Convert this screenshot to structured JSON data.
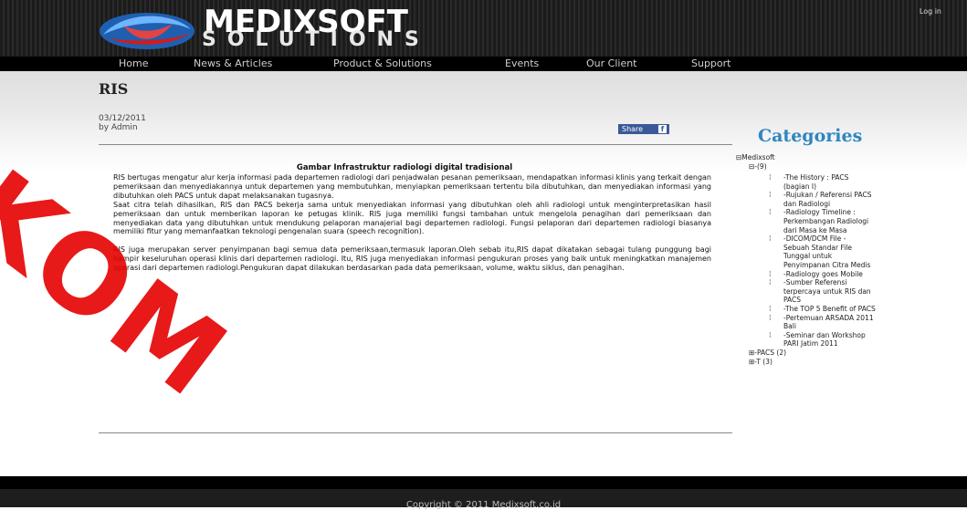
{
  "header": {
    "logo_line1": "MEDIXSOFT",
    "logo_line2": "SOLUTIONS",
    "login": "Log in"
  },
  "nav": {
    "items": [
      "Home",
      "News & Articles",
      "Product & Solutions",
      "Events",
      "Our Client",
      "Support"
    ]
  },
  "article": {
    "title": "RIS",
    "date": "03/12/2011",
    "author": "by Admin",
    "share": "Share",
    "image_caption": "Gambar Infrastruktur radiologi digital tradisional",
    "paragraph1": "RIS bertugas mengatur alur kerja informasi pada departemen radiologi dari penjadwalan pesanan pemeriksaan, mendapatkan informasi klinis yang terkait dengan pemeriksaan dan menyediakannya untuk departemen yang membutuhkan, menyiapkan pemeriksaan tertentu bila dibutuhkan, dan  menyediakan informasi yang dibutuhkan oleh PACS untuk dapat melaksanakan tugasnya.",
    "paragraph2": "Saat citra telah dihasilkan, RIS dan PACS bekerja sama untuk menyediakan informasi yang dibutuhkan oleh ahli radiologi untuk menginterpretasikan hasil pemeriksaan dan untuk memberikan laporan ke petugas klinik. RIS juga memiliki fungsi tambahan untuk mengelola penagihan dari pemeriksaan dan menyediakan data yang dibutuhkan untuk mendukung pelaporan manajerial bagi departemen radiologi. Fungsi pelaporan dari departemen radiologi biasanya memiliki fitur yang memanfaatkan teknologi pengenalan suara (speech recognition).",
    "paragraph3": "RIS juga merupakan server penyimpanan bagi semua data pemeriksaan,termasuk laporan.Oleh sebab itu,RIS dapat dikatakan sebagai tulang punggung bagi hampir keseluruhan operasi klinis dari departemen radiologi. Itu, RIS juga menyediakan informasi pengukuran proses yang baik untuk meningkatkan manajemen operasi dari departemen radiologi.Pengukuran dapat dilakukan berdasarkan pada data pemeriksaan, volume, waktu siklus, dan penagihan."
  },
  "categories": {
    "title": "Categories",
    "root": "Medixsoft",
    "group1": "-(9)",
    "leaves": [
      [
        "The History : PACS",
        "(bagian I)"
      ],
      [
        "Rujukan / Referensi PACS",
        "dan Radiologi"
      ],
      [
        "Radiology Timeline :",
        "Perkembangan Radiologi",
        "dari Masa ke Masa"
      ],
      [
        "DICOM/DCM File -",
        "Sebuah Standar File",
        "Tunggal untuk",
        "Penyimpanan Citra Medis"
      ],
      [
        "Radiology goes Mobile"
      ],
      [
        "Sumber Referensi",
        "terpercaya untuk RIS dan",
        "PACS"
      ],
      [
        "The TOP 5 Benefit of PACS"
      ],
      [
        "Pertemuan ARSADA 2011",
        "Bali"
      ],
      [
        "Seminar dan Workshop",
        "PARI Jatim 2011"
      ]
    ],
    "group2": "PACS (2)",
    "group3": "T (3)"
  },
  "footer": {
    "copyright": "Copyright © 2011 Medixsoft.co.id"
  },
  "watermark": {
    "text": "IKOM"
  }
}
